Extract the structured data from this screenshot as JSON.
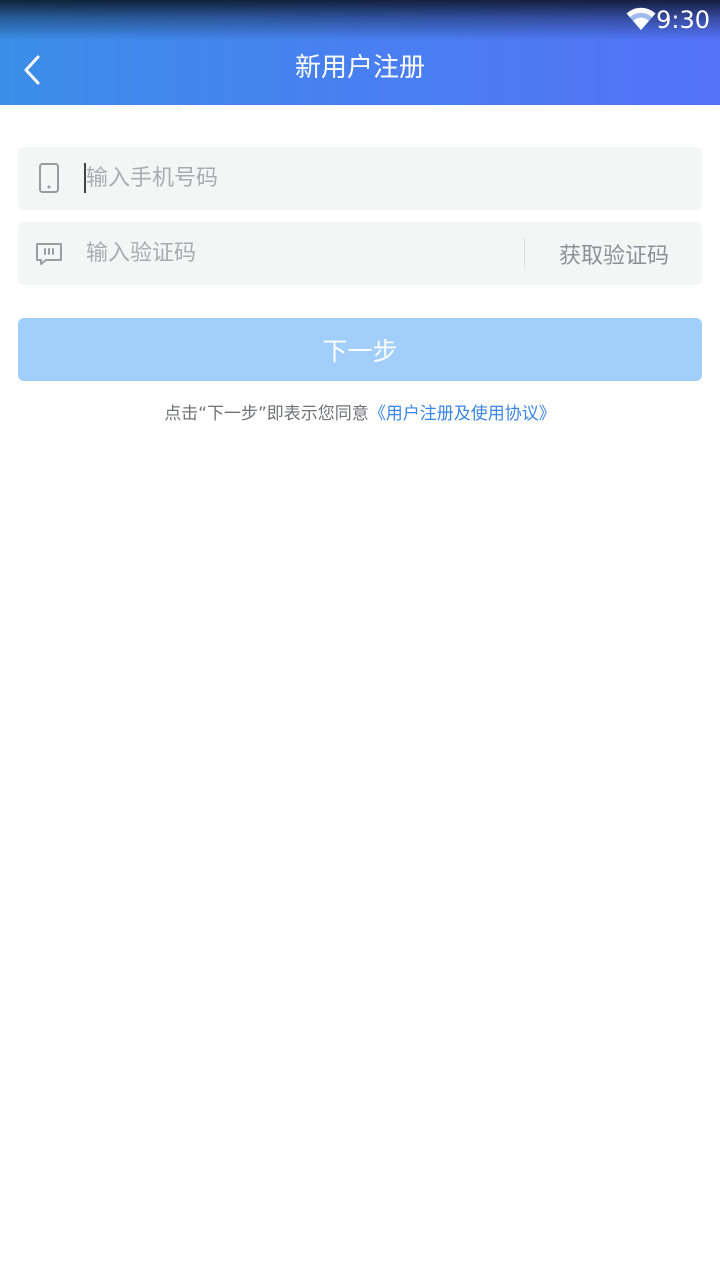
{
  "status_bar": {
    "time": "9:30"
  },
  "nav": {
    "title": "新用户注册"
  },
  "form": {
    "phone": {
      "placeholder": "输入手机号码",
      "value": ""
    },
    "code": {
      "placeholder": "输入验证码",
      "value": "",
      "get_code_label": "获取验证码"
    },
    "next_label": "下一步"
  },
  "agreement": {
    "prefix": "点击“下一步”即表示您同意",
    "link": "《用户注册及使用协议》"
  },
  "colors": {
    "header_gradient_start": "#3b8ee8",
    "header_gradient_end": "#5472f8",
    "button_disabled": "#a1cefb",
    "link": "#3a86e6",
    "field_background": "#f4f5f5"
  }
}
